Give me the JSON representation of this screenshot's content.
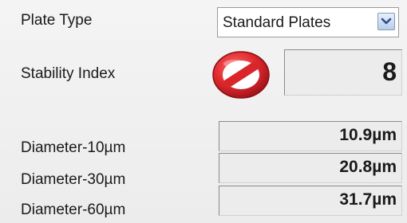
{
  "plate_type": {
    "label": "Plate Type",
    "selected": "Standard Plates"
  },
  "stability": {
    "label": "Stability Index",
    "value": "8",
    "icon": "no-entry-icon",
    "icon_color": "#d8262b"
  },
  "diameters": [
    {
      "label": "Diameter-10µm",
      "value": "10.9µm"
    },
    {
      "label": "Diameter-30µm",
      "value": "20.8µm"
    },
    {
      "label": "Diameter-60µm",
      "value": "31.7µm"
    }
  ]
}
